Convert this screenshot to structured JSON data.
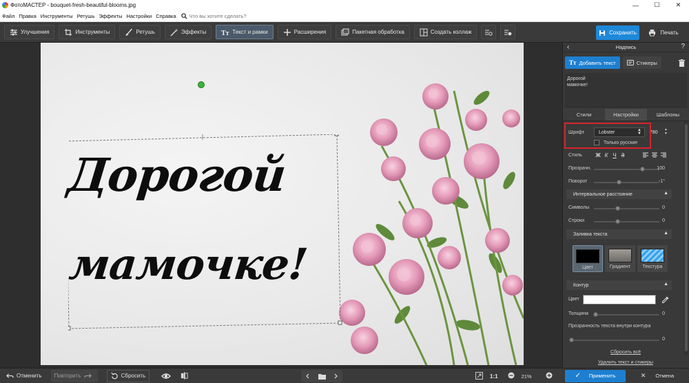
{
  "window": {
    "title": "ФотоМАСТЕР - bouquet-fresh-beautiful-blooms.jpg",
    "controls": [
      "minimize-icon",
      "maximize-icon",
      "close-icon"
    ]
  },
  "menu": {
    "items": [
      "Файл",
      "Правка",
      "Инструменты",
      "Ретушь",
      "Эффекты",
      "Настройки",
      "Справка"
    ],
    "search_placeholder": "Что вы хотите сделать?"
  },
  "toolbar": {
    "tabs": [
      {
        "label": "Улучшения",
        "icon": "sliders-icon"
      },
      {
        "label": "Инструменты",
        "icon": "crop-icon"
      },
      {
        "label": "Ретушь",
        "icon": "brush-icon"
      },
      {
        "label": "Эффекты",
        "icon": "magic-wand-icon"
      },
      {
        "label": "Текст и рамки",
        "icon": "text-icon",
        "active": true
      },
      {
        "label": "Расширения",
        "icon": "plus-icon"
      },
      {
        "label": "Пакетная обработка",
        "icon": "batch-icon"
      },
      {
        "label": "Создать коллаж",
        "icon": "collage-icon"
      }
    ],
    "save_label": "Сохранить",
    "print_label": "Печать"
  },
  "canvas": {
    "caption_line1": "Дорогой",
    "caption_line2": "мамочке!"
  },
  "statusbar": {
    "undo_label": "Отменить",
    "redo_label": "Повторить",
    "reset_label": "Сбросить",
    "fit_label": "1:1",
    "zoom_value": "21%"
  },
  "panel": {
    "title": "Надпись",
    "add_text_label": "Добавить текст",
    "stickers_label": "Стикеры",
    "preview_text_line1": "Дорогой",
    "preview_text_line2": "мамочке!",
    "subtabs": [
      "Стили",
      "Настройки",
      "Шаблоны"
    ],
    "font_label": "Шрифт",
    "font_value": "Lobster",
    "font_size": "780",
    "only_russian_label": "Только русские",
    "style_label": "Стиль",
    "style_buttons": [
      "Ж",
      "К",
      "Ч",
      "З"
    ],
    "opacity_label": "Прозрачн.",
    "opacity_value": "100",
    "rotation_label": "Поворот",
    "rotation_value": "-1°",
    "spacing_section": "Интервальное расстояние",
    "chars_label": "Символы",
    "chars_value": "0",
    "lines_label": "Строки",
    "lines_value": "0",
    "fill_section": "Заливка текста",
    "fill_options": [
      "Цвет",
      "Градиент",
      "Текстура"
    ],
    "outline_section": "Контур",
    "outline_color_label": "Цвет",
    "outline_color": "#ffffff",
    "thickness_label": "Толщина",
    "thickness_value": "0",
    "inner_opacity_label": "Прозрачность текста внутри контура",
    "inner_opacity_value": "0",
    "reset_all_label": "Сбросить всё",
    "delete_all_label": "Удалить текст и стикеры",
    "apply_label": "Применить",
    "cancel_label": "Отмена"
  },
  "colors": {
    "accent": "#1e88d9",
    "highlight": "#d6242b",
    "rotation_handle": "#3db33d"
  }
}
